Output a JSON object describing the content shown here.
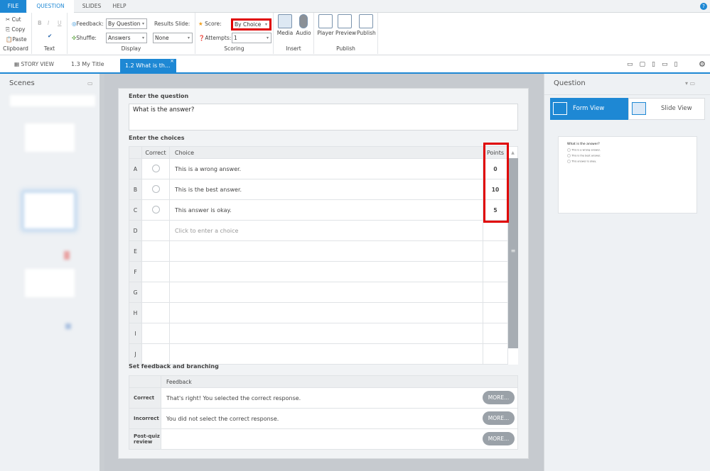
{
  "ribbon_tabs": [
    "FILE",
    "QUESTION",
    "SLIDES",
    "HELP"
  ],
  "clipboard": {
    "cut": "Cut",
    "copy": "Copy",
    "paste": "Paste",
    "label": "Clipboard"
  },
  "text": {
    "bold": "B",
    "italic": "I",
    "underline": "U",
    "label": "Text"
  },
  "display": {
    "feedback_label": "Feedback:",
    "feedback_value": "By Question",
    "shuffle_label": "Shuffle:",
    "shuffle_value": "Answers",
    "results_label": "Results Slide:",
    "results_value": "None",
    "label": "Display"
  },
  "scoring": {
    "score_label": "Score:",
    "score_value": "By Choice",
    "attempts_label": "Attempts:",
    "attempts_value": "1",
    "label": "Scoring"
  },
  "insert": {
    "media": "Media",
    "audio": "Audio",
    "label": "Insert"
  },
  "publish": {
    "player": "Player",
    "preview": "Preview",
    "publish": "Publish",
    "label": "Publish"
  },
  "doc_tabs": {
    "story_view": "STORY VIEW",
    "tab1": "1.3 My Title",
    "tab2": "1.2 What is th..."
  },
  "scenes": {
    "title": "Scenes"
  },
  "form": {
    "question_heading": "Enter the question",
    "question": "What is the answer?",
    "choices_heading": "Enter the choices",
    "columns": {
      "correct": "Correct",
      "choice": "Choice",
      "points": "Points"
    },
    "choices": [
      {
        "letter": "A",
        "text": "This is a wrong answer.",
        "points": "0"
      },
      {
        "letter": "B",
        "text": "This is the best answer.",
        "points": "10"
      },
      {
        "letter": "C",
        "text": "This answer is okay.",
        "points": "5"
      },
      {
        "letter": "D",
        "text": "",
        "placeholder": "Click to enter a choice",
        "points": ""
      },
      {
        "letter": "E",
        "text": "",
        "points": ""
      },
      {
        "letter": "F",
        "text": "",
        "points": ""
      },
      {
        "letter": "G",
        "text": "",
        "points": ""
      },
      {
        "letter": "H",
        "text": "",
        "points": ""
      },
      {
        "letter": "I",
        "text": "",
        "points": ""
      },
      {
        "letter": "J",
        "text": "",
        "points": ""
      }
    ],
    "feedback_heading": "Set feedback and branching",
    "feedback_col": "Feedback",
    "feedback": [
      {
        "label": "Correct",
        "text": "That's right!  You selected the correct response.",
        "button": "MORE..."
      },
      {
        "label": "Incorrect",
        "text": "You did not select the correct response.",
        "button": "MORE..."
      },
      {
        "label": "Post-quiz review",
        "text": "",
        "button": "MORE..."
      }
    ]
  },
  "right_panel": {
    "title": "Question",
    "form_view": "Form View",
    "slide_view": "Slide View",
    "preview_question": "What is the answer?",
    "preview_choices": [
      "This is a wrong answer.",
      "This is the best answer.",
      "This answer is okay."
    ]
  },
  "colors": {
    "accent": "#1e88d4",
    "highlight": "#e00000"
  }
}
